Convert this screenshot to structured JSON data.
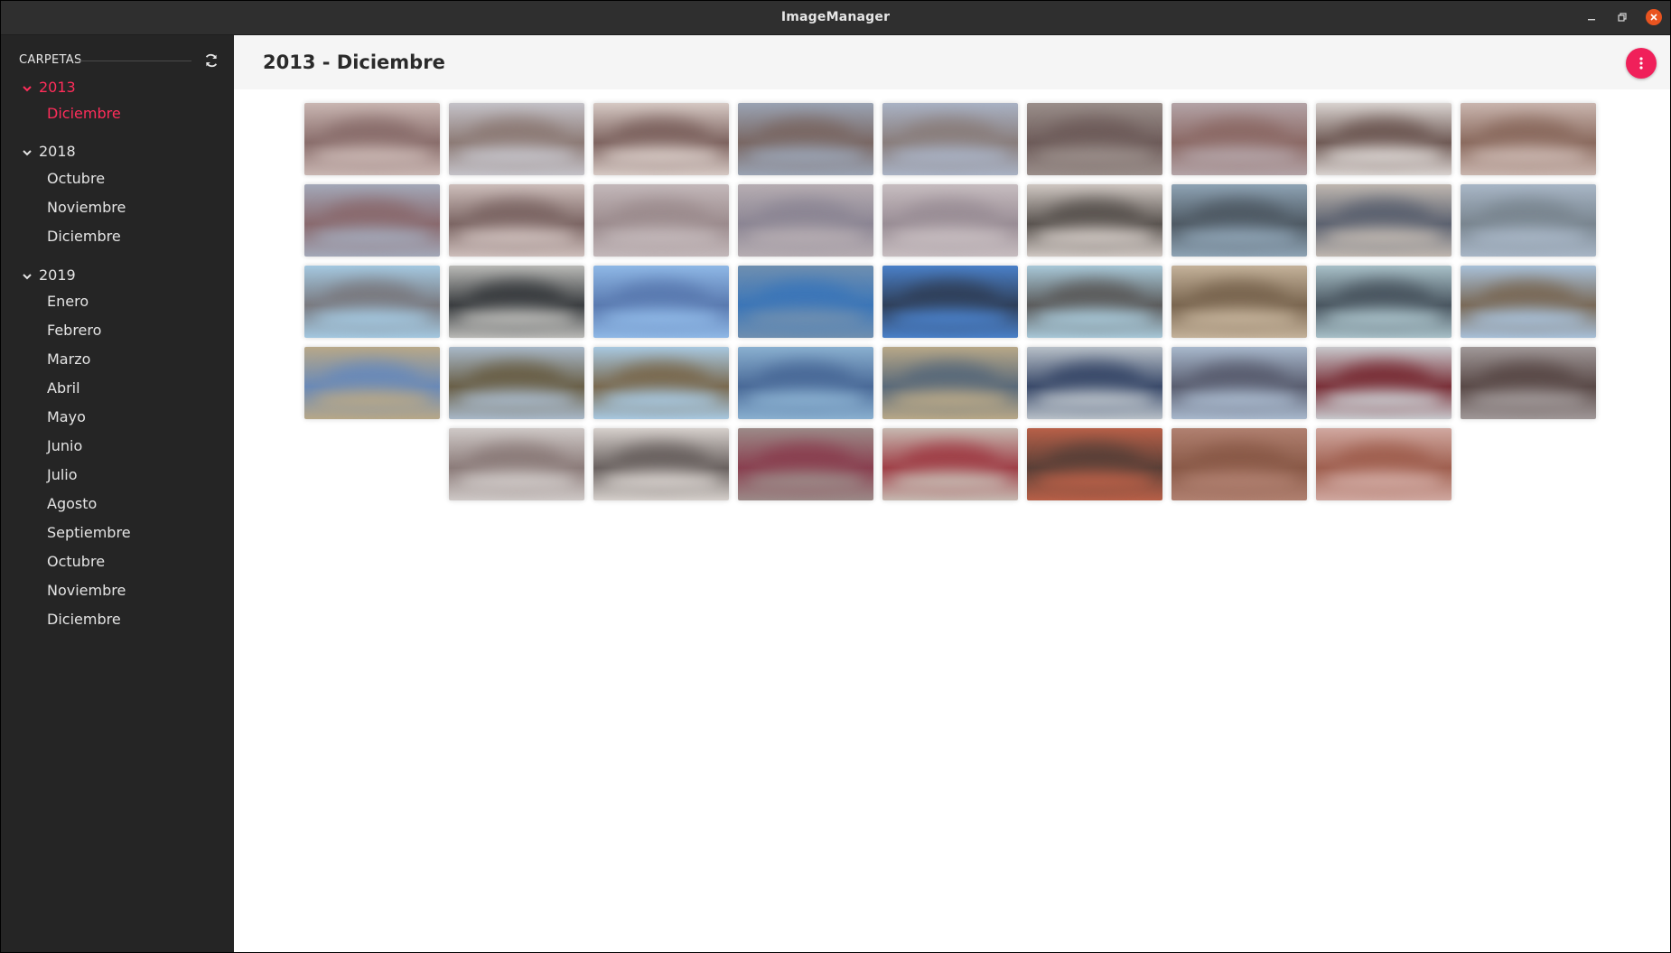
{
  "window": {
    "title": "ImageManager"
  },
  "sidebar": {
    "header": "CARPETAS",
    "years": [
      {
        "label": "2013",
        "expanded": true,
        "active": true,
        "months": [
          {
            "label": "Diciembre",
            "active": true
          }
        ]
      },
      {
        "label": "2018",
        "expanded": true,
        "active": false,
        "months": [
          {
            "label": "Octubre"
          },
          {
            "label": "Noviembre"
          },
          {
            "label": "Diciembre"
          }
        ]
      },
      {
        "label": "2019",
        "expanded": true,
        "active": false,
        "months": [
          {
            "label": "Enero"
          },
          {
            "label": "Febrero"
          },
          {
            "label": "Marzo"
          },
          {
            "label": "Abril"
          },
          {
            "label": "Mayo"
          },
          {
            "label": "Junio"
          },
          {
            "label": "Julio"
          },
          {
            "label": "Agosto"
          },
          {
            "label": "Septiembre"
          },
          {
            "label": "Octubre"
          },
          {
            "label": "Noviembre"
          },
          {
            "label": "Diciembre"
          }
        ]
      }
    ]
  },
  "main": {
    "title": "2013 - Diciembre",
    "menu_icon": "more-vertical-icon"
  },
  "colors": {
    "accent": "#f0205a",
    "sidebar_bg": "#252525",
    "titlebar_bg": "#2f2f2f",
    "close_button": "#e95420"
  },
  "thumbnails": [
    [
      "#8a6e6c",
      "#c9b6b2"
    ],
    [
      "#8d7b76",
      "#c4c2c8"
    ],
    [
      "#7e6460",
      "#d6c9c4"
    ],
    [
      "#7a6864",
      "#9aa3b3"
    ],
    [
      "#8a7e7c",
      "#a9b2c4"
    ],
    [
      "#6e5c5a",
      "#9a8e8a"
    ],
    [
      "#8c6a66",
      "#b3a3a6"
    ],
    [
      "#6f5a55",
      "#d9d3d0"
    ],
    [
      "#8b6b5f",
      "#c9b5ae"
    ],
    [
      "#8a6a6e",
      "#a3a8b8"
    ],
    [
      "#7c6664",
      "#cdbebb"
    ],
    [
      "#9c8c8e",
      "#c3b8ba"
    ],
    [
      "#8c8694",
      "#b6adb2"
    ],
    [
      "#9a8e96",
      "#c7bdc0"
    ],
    [
      "#5a5450",
      "#cfc7c2"
    ],
    [
      "#4f5a64",
      "#8ea3b4"
    ],
    [
      "#5c6270",
      "#bfb7b0"
    ],
    [
      "#7a8690",
      "#a8b6c6"
    ],
    [
      "#7a7a80",
      "#a4c8e0"
    ],
    [
      "#3a3d40",
      "#b9b9b6"
    ],
    [
      "#5a7ab0",
      "#8fb8e6"
    ],
    [
      "#3c76b8",
      "#6f8fb0"
    ],
    [
      "#30405a",
      "#4a80c8"
    ],
    [
      "#5c5c5c",
      "#a8c8d8"
    ],
    [
      "#7a6650",
      "#c4b29a"
    ],
    [
      "#4a5660",
      "#a8c0c8"
    ],
    [
      "#7a6a58",
      "#a8c0d8"
    ],
    [
      "#6a8ab8",
      "#b8a888"
    ],
    [
      "#6a6048",
      "#a8b8c8"
    ],
    [
      "#7a6a50",
      "#a8c8e0"
    ],
    [
      "#4a6a98",
      "#8ab0d0"
    ],
    [
      "#5a6a7a",
      "#b8a888"
    ],
    [
      "#3a4a6a",
      "#b8c0c8"
    ],
    [
      "#5a5e70",
      "#a8b8cc"
    ],
    [
      "#7a3038",
      "#c8c8cc"
    ],
    [
      "#5a4a48",
      "#a09898"
    ],
    [
      "#8c7c7a",
      "#cfc9c7"
    ],
    [
      "#6a6260",
      "#d6d0cc"
    ],
    [
      "#8a4050",
      "#9c8a88"
    ],
    [
      "#a04048",
      "#c6b8b0"
    ],
    [
      "#5a4038",
      "#b86048"
    ],
    [
      "#8a5a48",
      "#b08070"
    ],
    [
      "#a06050",
      "#d0a8a0"
    ]
  ]
}
